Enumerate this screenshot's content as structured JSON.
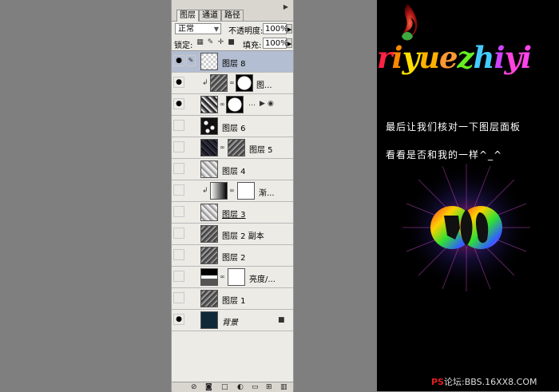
{
  "panel": {
    "tabs": [
      "图层",
      "通道",
      "路径"
    ],
    "blend_mode": "正常",
    "opacity_label": "不透明度:",
    "opacity_value": "100%",
    "lock_label": "锁定:",
    "fill_label": "填充:",
    "fill_value": "100%",
    "layers": [
      {
        "name": "图层 8",
        "selected": true,
        "visible": true
      },
      {
        "name": "图...",
        "visible": true
      },
      {
        "name": "",
        "visible": true
      },
      {
        "name": "图层 6",
        "visible": false
      },
      {
        "name": "图层 5",
        "visible": false
      },
      {
        "name": "图层 4",
        "visible": false
      },
      {
        "name": "渐...",
        "visible": false
      },
      {
        "name": "图层 3",
        "visible": false
      },
      {
        "name": "图层 2 副本",
        "visible": false
      },
      {
        "name": "图层 2",
        "visible": false
      },
      {
        "name": "亮度/...",
        "visible": false
      },
      {
        "name": "图层 1",
        "visible": false
      },
      {
        "name": "背景",
        "visible": true,
        "locked": true
      }
    ]
  },
  "canvas": {
    "title_letters": [
      "r",
      "i",
      "y",
      "u",
      "e",
      "z",
      "h",
      "i",
      "y",
      "i"
    ],
    "title_colors": [
      "#ff2244",
      "#ff8800",
      "#ffe000",
      "#ffb000",
      "#ff9933",
      "#66ee22",
      "#44ccff",
      "#cc44ff",
      "#ff44dd",
      "#ff44ee"
    ],
    "line1": "最后让我们核对一下图层面板",
    "line2": "看看是否和我的一样^_^",
    "footer_ps": "PS",
    "footer_rest": "论坛:BBS.16XX8.COM"
  }
}
